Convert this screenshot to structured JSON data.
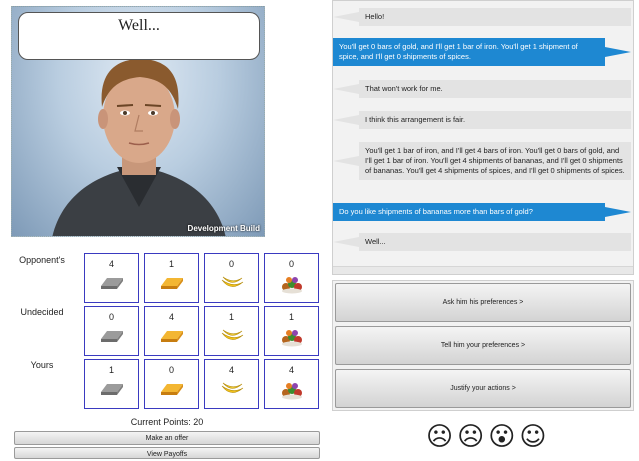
{
  "agent": {
    "speech": "Well...",
    "build_label": "Development Build"
  },
  "grid": {
    "rows": [
      {
        "label": "Opponent's",
        "counts": [
          "4",
          "1",
          "0",
          "0"
        ]
      },
      {
        "label": "Undecided",
        "counts": [
          "0",
          "4",
          "1",
          "1"
        ]
      },
      {
        "label": "Yours",
        "counts": [
          "1",
          "0",
          "4",
          "4"
        ]
      }
    ],
    "item_icons": [
      "iron-bar-icon",
      "gold-bar-icon",
      "bananas-icon",
      "spices-icon"
    ],
    "colors": {
      "cell_border": "#3a3ac0",
      "iron": "#8a8a8a",
      "gold": "#e8a21a",
      "banana": "#f2c21b"
    }
  },
  "current_points": "Current Points: 20",
  "buttons": {
    "make_offer": "Make an offer",
    "view_payoffs": "View Payoffs",
    "ask_prefs": "Ask him his preferences >",
    "tell_prefs": "Tell him your preferences >",
    "justify": "Justify your actions >"
  },
  "chat": [
    {
      "from": "them",
      "text": "Hello!"
    },
    {
      "from": "me",
      "text": "You'll get 0 bars of gold, and I'll get 1 bar of iron. You'll get 1 shipment of spice, and I'll get 0 shipments of spices."
    },
    {
      "from": "them",
      "text": "That won't work for me."
    },
    {
      "from": "them",
      "text": "I think this arrangement is fair."
    },
    {
      "from": "them",
      "text": "You'll get 1 bar of iron, and I'll get 4 bars of iron. You'll get 0 bars of gold, and I'll get 1 bar of iron. You'll get 4 shipments of bananas, and I'll get 0 shipments of bananas. You'll get 4 shipments of spices, and I'll get 0 shipments of spices."
    },
    {
      "from": "me",
      "text": "Do you like shipments of bananas more than bars of gold?"
    },
    {
      "from": "them",
      "text": "Well..."
    }
  ],
  "emotions": [
    {
      "name": "angry-face-icon",
      "glyph": "☹"
    },
    {
      "name": "sad-face-icon",
      "glyph": "☹"
    },
    {
      "name": "surprised-face-icon",
      "glyph": "😮"
    },
    {
      "name": "happy-face-icon",
      "glyph": "☺"
    }
  ],
  "colors": {
    "me_bubble": "#1e88d2",
    "them_bubble": "#e3e3e3"
  }
}
